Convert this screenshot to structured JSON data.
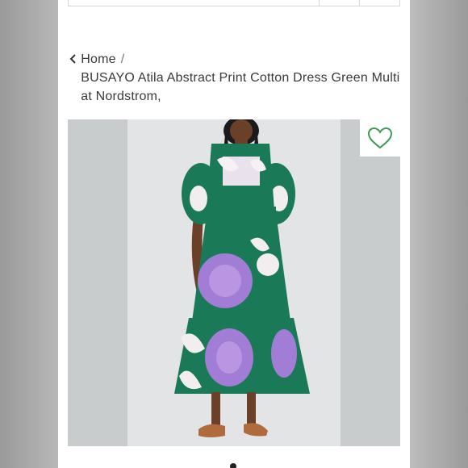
{
  "breadcrumb": {
    "home_label": "Home",
    "separator": "/",
    "product_title": "BUSAYO Atila Abstract Print Cotton Dress Green Multi at Nordstrom,"
  },
  "icons": {
    "back": "chevron-left-icon",
    "favorite": "heart-outline-icon"
  },
  "colors": {
    "accent_green": "#3f9a57",
    "dress_green": "#1a7a57",
    "dress_purple": "#a27dd6"
  }
}
